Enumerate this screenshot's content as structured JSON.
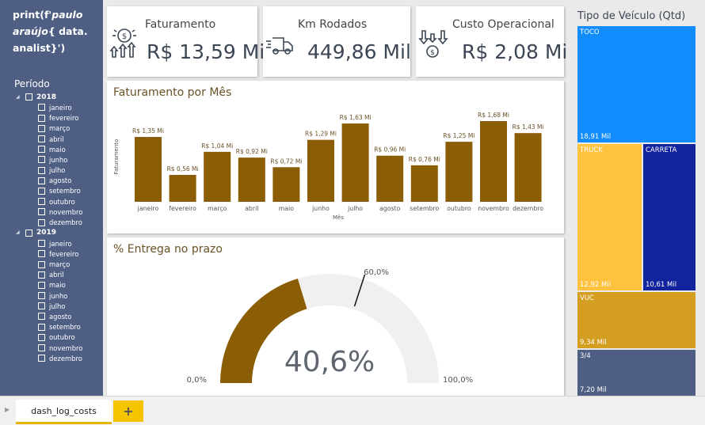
{
  "logo": {
    "line1_a": "print(f'",
    "line1_b": "paulo",
    "line2_a": "araújo",
    "line2_b": "{ data.",
    "line3": "analist}')"
  },
  "slicer": {
    "title": "Período",
    "years": [
      {
        "label": "2018",
        "months": [
          "janeiro",
          "fevereiro",
          "março",
          "abril",
          "maio",
          "junho",
          "julho",
          "agosto",
          "setembro",
          "outubro",
          "novembro",
          "dezembro"
        ]
      },
      {
        "label": "2019",
        "months": [
          "janeiro",
          "fevereiro",
          "março",
          "abril",
          "maio",
          "junho",
          "julho",
          "agosto",
          "setembro",
          "outubro",
          "novembro",
          "dezembro"
        ]
      }
    ]
  },
  "kpis": {
    "faturamento": {
      "title": "Faturamento",
      "value": "R$ 13,59 Mi",
      "icon": "money-growth-icon"
    },
    "km": {
      "title": "Km Rodados",
      "value": "449,86 Mil",
      "icon": "delivery-truck-icon"
    },
    "custo": {
      "title": "Custo Operacional",
      "value": "R$ 2,08 Mi",
      "icon": "cost-down-icon"
    }
  },
  "chart_data": [
    {
      "type": "bar",
      "title": "Faturamento por Mês",
      "xlabel": "Mês",
      "ylabel": "Faturamento",
      "categories": [
        "janeiro",
        "fevereiro",
        "março",
        "abril",
        "maio",
        "junho",
        "julho",
        "agosto",
        "setembro",
        "outubro",
        "novembro",
        "dezembro"
      ],
      "values": [
        1.35,
        0.56,
        1.04,
        0.92,
        0.72,
        1.29,
        1.63,
        0.96,
        0.76,
        1.25,
        1.68,
        1.43
      ],
      "labels": [
        "R$ 1,35 Mi",
        "R$ 0,56 Mi",
        "R$ 1,04 Mi",
        "R$ 0,92 Mi",
        "R$ 0,72 Mi",
        "R$ 1,29 Mi",
        "R$ 1,63 Mi",
        "R$ 0,96 Mi",
        "R$ 0,76 Mi",
        "R$ 1,25 Mi",
        "R$ 1,68 Mi",
        "R$ 1,43 Mi"
      ],
      "ylim": [
        0,
        1.68
      ],
      "grid": false,
      "color": "#8b5e05"
    },
    {
      "type": "gauge",
      "title": "% Entrega no prazo",
      "value": 40.6,
      "value_label": "40,6%",
      "min": 0,
      "max": 100,
      "min_label": "0,0%",
      "max_label": "100,0%",
      "target": 60,
      "target_label": "60,0%",
      "fill_color": "#8b5e05",
      "track_color": "#f1f0ef"
    },
    {
      "type": "treemap",
      "title": "Tipo de Veículo (Qtd)",
      "items": [
        {
          "name": "TOCO",
          "value": 18.91,
          "label": "18,91 Mil",
          "color": "#118dff"
        },
        {
          "name": "TRUCK",
          "value": 12.92,
          "label": "12,92 Mil",
          "color": "#fec23f"
        },
        {
          "name": "CARRETA",
          "value": 10.61,
          "label": "10,61 Mil",
          "color": "#12239e"
        },
        {
          "name": "VUC",
          "value": 9.34,
          "label": "9,34 Mil",
          "color": "#d49e20"
        },
        {
          "name": "3/4",
          "value": 7.2,
          "label": "7,20 Mil",
          "color": "#4f5f83"
        }
      ]
    }
  ],
  "tabs": {
    "active": "dash_log_costs",
    "add": "+"
  }
}
